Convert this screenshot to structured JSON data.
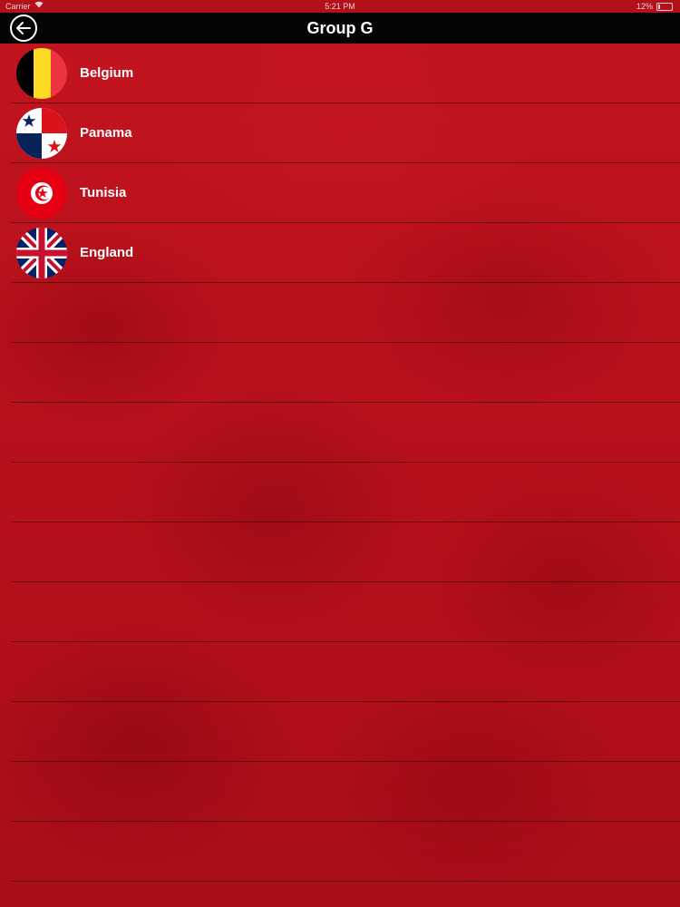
{
  "status_bar": {
    "carrier": "Carrier",
    "wifi_icon": "wifi-icon",
    "time": "5:21 PM",
    "battery_percent": "12%",
    "battery_icon": "battery-icon"
  },
  "nav": {
    "back_icon": "arrow-left-circle-icon",
    "title": "Group G"
  },
  "teams": [
    {
      "name": "Belgium",
      "flag_icon": "belgium-flag-icon"
    },
    {
      "name": "Panama",
      "flag_icon": "panama-flag-icon"
    },
    {
      "name": "Tunisia",
      "flag_icon": "tunisia-flag-icon"
    },
    {
      "name": "England",
      "flag_icon": "england-flag-icon"
    }
  ],
  "empty_rows": 10,
  "colors": {
    "background": "#b5101a",
    "nav_bar": "#050505",
    "text": "#ffffff"
  }
}
